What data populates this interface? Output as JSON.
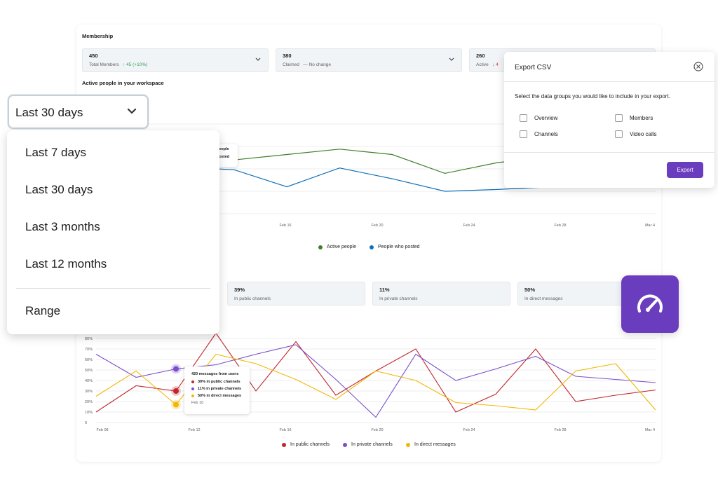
{
  "membership": {
    "title": "Membership",
    "stats": [
      {
        "value": "450",
        "label": "Total Members",
        "change": "↑ 45 (+10%)",
        "change_type": "up"
      },
      {
        "value": "380",
        "label": "Claimed",
        "change": "— No change",
        "change_type": "none"
      },
      {
        "value": "260",
        "label": "Active",
        "change": "↓ 4",
        "change_type": "down"
      }
    ]
  },
  "active_section": {
    "title": "Active people in your workspace",
    "tooltip_lines": [
      "people",
      "posted"
    ]
  },
  "chart_data": [
    {
      "type": "line",
      "x_ticks": [
        "Feb 16",
        "Feb 20",
        "Feb 24",
        "Feb 28",
        "Mar 4"
      ],
      "series": [
        {
          "name": "Active people",
          "color": "#3f7f2a",
          "values": [
            68,
            60,
            66,
            72,
            66,
            45,
            57,
            63,
            73,
            79
          ]
        },
        {
          "name": "People who posted",
          "color": "#1170b8",
          "values": [
            52,
            49,
            30,
            51,
            39,
            25,
            27,
            30,
            41,
            49
          ]
        }
      ]
    },
    {
      "type": "line",
      "x_ticks": [
        "Feb 08",
        "Feb 12",
        "Feb 16",
        "Feb 20",
        "Feb 24",
        "Feb 28",
        "Mar 4"
      ],
      "y_ticks": [
        "0",
        "10%",
        "20%",
        "30%",
        "40%",
        "50%",
        "60%",
        "70%",
        "80%"
      ],
      "ylim": [
        0,
        80
      ],
      "series": [
        {
          "name": "In public channels",
          "color": "#c1272d",
          "values": [
            10,
            35,
            30,
            85,
            30,
            77,
            26,
            49,
            70,
            10,
            27,
            70,
            20,
            26,
            31
          ]
        },
        {
          "name": "In private channels",
          "color": "#7b4fc9",
          "values": [
            65,
            43,
            51,
            55,
            65,
            74,
            41,
            5,
            65,
            40,
            51,
            63,
            44,
            41,
            38
          ]
        },
        {
          "name": "In direct messages",
          "color": "#f2b705",
          "values": [
            25,
            49,
            17,
            65,
            56,
            41,
            22,
            49,
            40,
            19,
            16,
            12,
            49,
            56,
            12
          ]
        }
      ]
    }
  ],
  "channel_stats": [
    {
      "value": "39%",
      "label": "In public channels"
    },
    {
      "value": "11%",
      "label": "In private channels"
    },
    {
      "value": "50%",
      "label": "In direct messages"
    }
  ],
  "messages_tooltip": {
    "title": "420 messages from users",
    "rows": [
      {
        "label": "39% in public channels",
        "color": "#c1272d"
      },
      {
        "label": "11% in private channels",
        "color": "#7b4fc9"
      },
      {
        "label": "50% in direct messages",
        "color": "#f2b705"
      }
    ],
    "date": "Feb 10"
  },
  "date_filter": {
    "selected": "Last 30 days",
    "options": [
      "Last 7 days",
      "Last 30 days",
      "Last 3 months",
      "Last 12 months"
    ],
    "range_label": "Range"
  },
  "export_modal": {
    "title": "Export CSV",
    "description": "Select the data groups you would like to include in your export.",
    "options": [
      "Overview",
      "Members",
      "Channels",
      "Video calls"
    ],
    "button_label": "Export"
  },
  "gauge_badge": {
    "icon": "speedometer-icon",
    "color": "#6a3dbf"
  }
}
